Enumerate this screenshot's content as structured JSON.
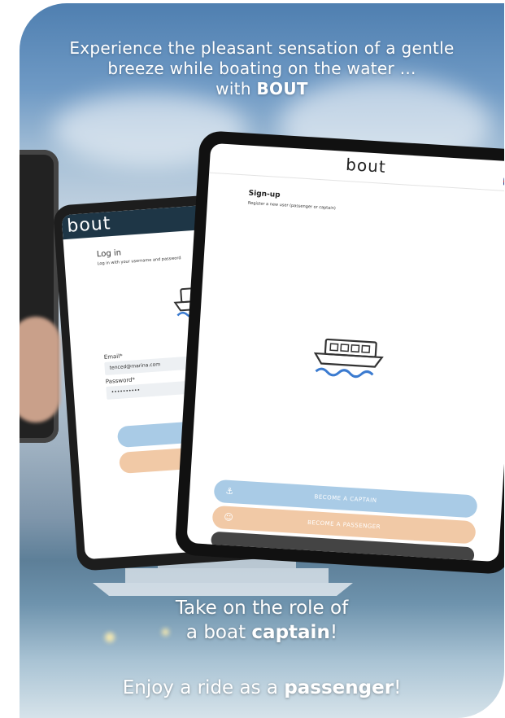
{
  "headline": {
    "line1": "Experience the pleasant sensation of a gentle",
    "line2": "breeze while boating on the water ...",
    "line3_prefix": "with ",
    "line3_brand": "BOUT"
  },
  "login_screen": {
    "logo": "bout",
    "title": "Log in",
    "subtitle": "Log in with your username and password",
    "email_label": "Email*",
    "email_value": "tenced@marina.com",
    "password_label": "Password*",
    "password_value": "••••••••••",
    "boat_icon": "boat-icon"
  },
  "signup_screen": {
    "logo": "bout",
    "language_icon": "uk-flag-icon",
    "title": "Sign-up",
    "subtitle": "Register a new user (passenger or captain)",
    "boat_icon": "boat-icon",
    "captain_button": "BECOME A CAPTAIN",
    "passenger_button": "BECOME A PASSENGER",
    "captain_icon": "captain-hat-icon",
    "passenger_icon": "passenger-icon"
  },
  "colors": {
    "blue_button": "#a9cbe6",
    "peach_button": "#f1c9a6",
    "dark_bar": "#1e3646"
  },
  "tagline": {
    "line1": "Take on the role of",
    "line2_prefix": "a boat ",
    "line2_bold": "captain",
    "line2_suffix": "!",
    "line3_prefix": "Enjoy a ride as a ",
    "line3_bold": "passenger",
    "line3_suffix": "!"
  }
}
